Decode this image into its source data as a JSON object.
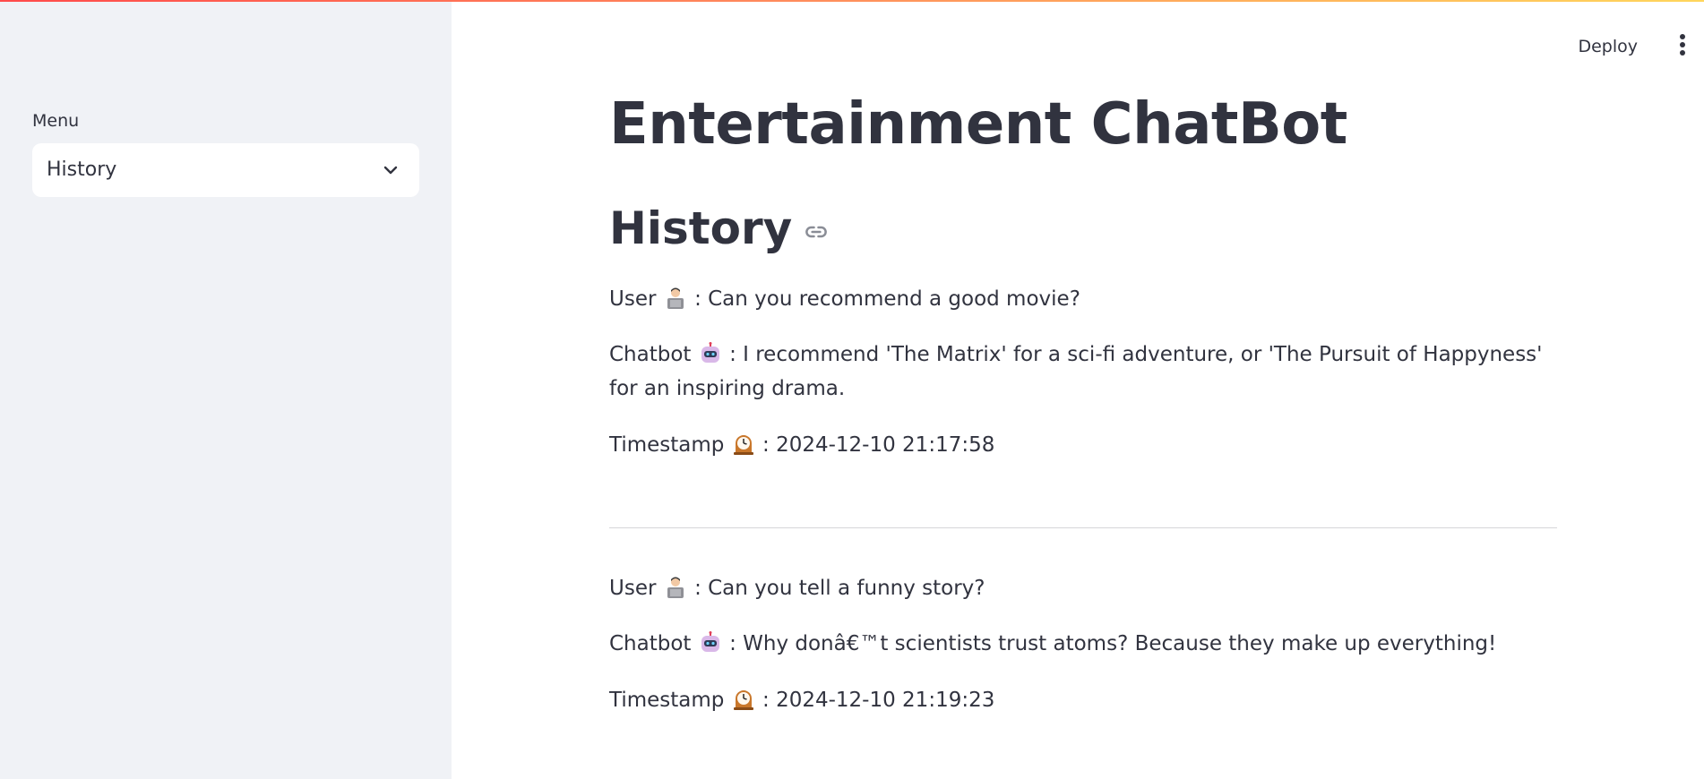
{
  "sidebar": {
    "menu_label": "Menu",
    "select": {
      "value": "History",
      "icon": "chevron-down-icon"
    }
  },
  "header": {
    "deploy_label": "Deploy",
    "more_icon": "kebab-menu-icon"
  },
  "main": {
    "title": "Entertainment ChatBot",
    "section_title": "History",
    "entries": [
      {
        "user_label": "User",
        "user_text": ": Can you recommend a good movie?",
        "bot_label": "Chatbot",
        "bot_text": ": I recommend 'The Matrix' for a sci-fi adventure, or 'The Pursuit of Happyness' for an inspiring drama.",
        "time_label": "Timestamp",
        "time_text": ": 2024-12-10 21:17:58"
      },
      {
        "user_label": "User",
        "user_text": ": Can you tell a funny story?",
        "bot_label": "Chatbot",
        "bot_text": ": Why donâ€™t scientists trust atoms? Because they make up everything!",
        "time_label": "Timestamp",
        "time_text": ": 2024-12-10 21:19:23"
      }
    ]
  },
  "colors": {
    "sidebar_bg": "#f0f2f6",
    "text": "#31333f",
    "accent_start": "#ff4b4b",
    "accent_end": "#ffd65c"
  }
}
